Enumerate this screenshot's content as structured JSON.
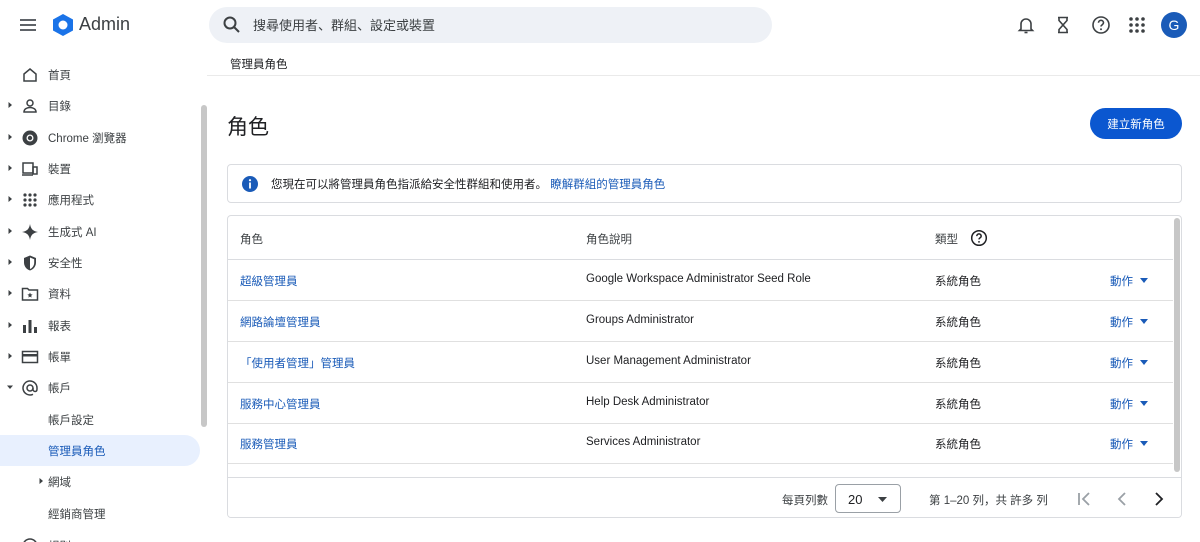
{
  "header": {
    "app_title": "Admin",
    "search_placeholder": "搜尋使用者、群組、設定或裝置",
    "avatar_letter": "G",
    "icons": [
      "menu-icon",
      "admin-logo-icon",
      "search-icon",
      "bell-icon",
      "hourglass-icon",
      "help-icon",
      "apps-grid-icon"
    ]
  },
  "sidebar": {
    "items": [
      {
        "label": "首頁",
        "icon": "home-icon"
      },
      {
        "label": "目錄",
        "icon": "person-icon"
      },
      {
        "label": "Chrome 瀏覽器",
        "icon": "chrome-icon"
      },
      {
        "label": "裝置",
        "icon": "devices-icon"
      },
      {
        "label": "應用程式",
        "icon": "apps-grid-icon"
      },
      {
        "label": "生成式 AI",
        "icon": "sparkle-icon"
      },
      {
        "label": "安全性",
        "icon": "shield-icon"
      },
      {
        "label": "資料",
        "icon": "data-folder-icon"
      },
      {
        "label": "報表",
        "icon": "bar-chart-icon"
      },
      {
        "label": "帳單",
        "icon": "credit-card-icon"
      },
      {
        "label": "帳戶",
        "icon": "at-sign-icon"
      }
    ],
    "subitems": [
      {
        "label": "帳戶設定"
      },
      {
        "label": "管理員角色"
      },
      {
        "label": "網域"
      },
      {
        "label": "經銷商管理"
      }
    ],
    "clipped_item": "規則"
  },
  "breadcrumb": "管理員角色",
  "page_title": "角色",
  "create_button": "建立新角色",
  "info": {
    "text": "您現在可以將管理員角色指派給安全性群組和使用者。",
    "link": "瞭解群組的管理員角色"
  },
  "table": {
    "headers": {
      "role": "角色",
      "description": "角色說明",
      "type": "類型"
    },
    "rows": [
      {
        "role": "超級管理員",
        "description": "Google Workspace Administrator Seed Role",
        "type": "系統角色",
        "action": "動作"
      },
      {
        "role": "網路論壇管理員",
        "description": "Groups Administrator",
        "type": "系統角色",
        "action": "動作"
      },
      {
        "role": "「使用者管理」管理員",
        "description": "User Management Administrator",
        "type": "系統角色",
        "action": "動作"
      },
      {
        "role": "服務中心管理員",
        "description": "Help Desk Administrator",
        "type": "系統角色",
        "action": "動作"
      },
      {
        "role": "服務管理員",
        "description": "Services Administrator",
        "type": "系統角色",
        "action": "動作"
      }
    ],
    "rows_per_page_label": "每頁列數",
    "rows_per_page_value": "20",
    "range_text": "第 1–20 列，共 許多 列"
  },
  "colors": {
    "accent": "#0b57d0",
    "link": "#1a5bb8",
    "active_bg": "#e8f0fe"
  }
}
